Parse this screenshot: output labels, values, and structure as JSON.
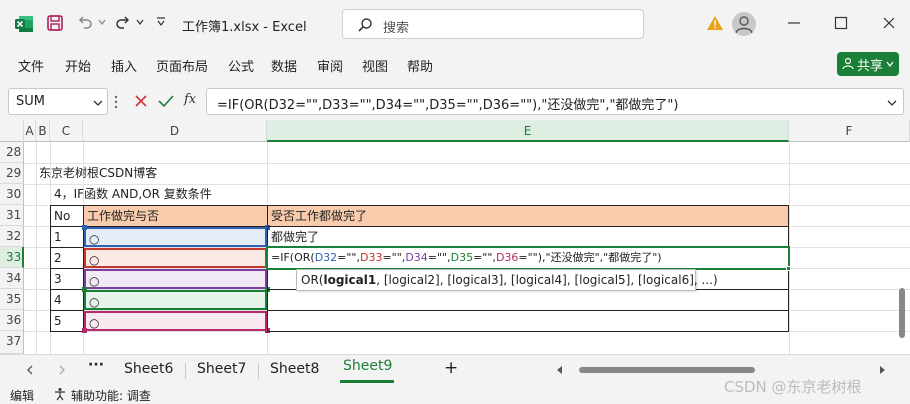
{
  "titlebar": {
    "title": "工作簿1.xlsx  -  Excel",
    "search_placeholder": "搜索"
  },
  "ribbon": {
    "tabs": [
      "文件",
      "开始",
      "插入",
      "页面布局",
      "公式",
      "数据",
      "审阅",
      "视图",
      "帮助"
    ],
    "share_label": "共享"
  },
  "formula_bar": {
    "name_box": "SUM",
    "fx_label": "fx",
    "formula": "=IF(OR(D32=\"\",D33=\"\",D34=\"\",D35=\"\",D36=\"\"),\"还没做完\",\"都做完了\")"
  },
  "grid": {
    "columns": [
      "A",
      "B",
      "C",
      "D",
      "E",
      "F"
    ],
    "active_column": "E",
    "rows": [
      "28",
      "29",
      "30",
      "31",
      "32",
      "33",
      "34",
      "35",
      "36",
      "37"
    ],
    "active_row": "33",
    "c29": "东京老树根CSDN博客",
    "c30": "4，IF函数 AND,OR 复数条件",
    "table_header": {
      "no": "No",
      "d": "工作做完与否",
      "e": "受否工作都做完了"
    },
    "table_rows": [
      {
        "no": "1",
        "e": "都做完了"
      },
      {
        "no": "2",
        "e": ""
      },
      {
        "no": "3",
        "e": ""
      },
      {
        "no": "4",
        "e": ""
      },
      {
        "no": "5",
        "e": ""
      }
    ],
    "radio_glyph": "○",
    "edit_formula_parts": [
      "=IF(OR(",
      "D32",
      "=\"\",",
      "D33",
      "=\"\",",
      "D34",
      "=\"\",",
      "D35",
      "=\"\",",
      "D36",
      "=\"\"),\"还没做完\",\"都做完了\")"
    ],
    "tooltip_parts": [
      "OR(",
      "logical1",
      ", [logical2], [logical3], [logical4], [logical5], [logical6], ...)"
    ],
    "ref_colors": [
      "#2f5fb3",
      "#c0392b",
      "#7b3fa0",
      "#1a7f37",
      "#b5286b"
    ]
  },
  "sheets": {
    "ellipsis": "···",
    "tabs": [
      "Sheet6",
      "Sheet7",
      "Sheet8",
      "Sheet9"
    ],
    "active": "Sheet9",
    "add_label": "+"
  },
  "status": {
    "mode": "编辑",
    "accessibility": "辅助功能: 调查"
  },
  "watermark": "CSDN @东京老树根"
}
